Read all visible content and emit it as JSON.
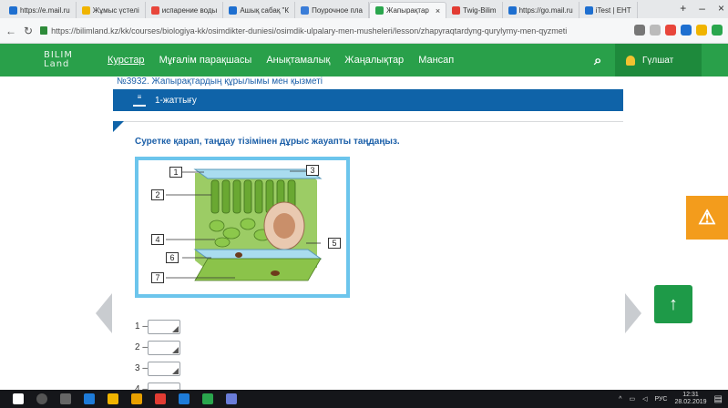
{
  "browser": {
    "tabs": [
      {
        "label": "https://e.mail.ru",
        "color": "#1e6fd0",
        "active": false
      },
      {
        "label": "Жұмыс үстелі",
        "color": "#f0b400",
        "active": false
      },
      {
        "label": "испарение воды",
        "color": "#e8463b",
        "active": false
      },
      {
        "label": "Ашық сабақ \"К",
        "color": "#1e6fd0",
        "active": false
      },
      {
        "label": "Поурочное пла",
        "color": "#3a7dd8",
        "active": false
      },
      {
        "label": "Жапырақтар",
        "color": "#2aa64d",
        "active": true
      },
      {
        "label": "Twig-Bilim",
        "color": "#e23c33",
        "active": false
      },
      {
        "label": "https://go.mail.ru",
        "color": "#1e6fd0",
        "active": false
      },
      {
        "label": "iTest | ЕНТ",
        "color": "#1e6fd0",
        "active": false
      }
    ],
    "url": "https://bilimland.kz/kk/courses/biologiya-kk/osimdikter-duniesi/osimdik-ulpalary-men-musheleri/lesson/zhapyraqtardyng-qurylymy-men-qyzmeti"
  },
  "site": {
    "logo_line1": "BILIM",
    "logo_line2": "Land",
    "nav": [
      "Курстар",
      "Мұғалім парақшасы",
      "Анықтамалық",
      "Жаңалықтар",
      "Мансап"
    ],
    "user": "Гүлшат"
  },
  "lesson": {
    "breadcrumb": "№3932. Жапырақтардың құрылымы мен қызметі",
    "exercise": "1-жаттығу",
    "question": "Суретке қарап, таңдау тізімінен дұрыс жауапты таңдаңыз.",
    "figure_labels": [
      "1",
      "2",
      "3",
      "4",
      "5",
      "6",
      "7"
    ],
    "answers": [
      {
        "num": "1 –",
        "value": ""
      },
      {
        "num": "2 –",
        "value": ""
      },
      {
        "num": "3 –",
        "value": ""
      },
      {
        "num": "4 –",
        "value": ""
      }
    ]
  },
  "taskbar": {
    "lang": "РУС",
    "time": "12:31",
    "date": "28.02.2019"
  }
}
